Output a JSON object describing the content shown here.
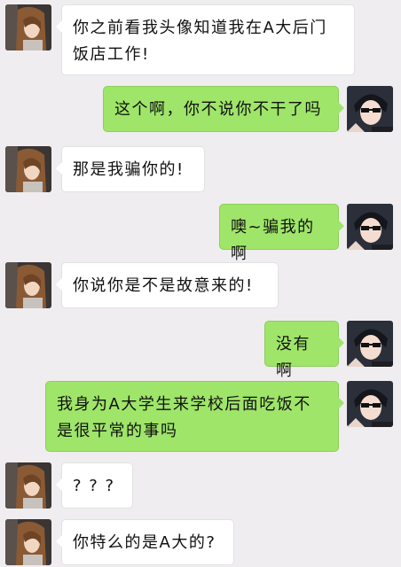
{
  "messages": [
    {
      "side": "left",
      "text": "你之前看我头像知道我在A大后门饭店工作!"
    },
    {
      "side": "right",
      "text": "这个啊，你不说你不干了吗"
    },
    {
      "side": "left",
      "text": "那是我骗你的!"
    },
    {
      "side": "right",
      "text": "噢~骗我的啊"
    },
    {
      "side": "left",
      "text": "你说你是不是故意来的!"
    },
    {
      "side": "right",
      "text": "没有啊"
    },
    {
      "side": "right",
      "text": "我身为A大学生来学校后面吃饭不是很平常的事吗"
    },
    {
      "side": "left",
      "text": "? ? ?"
    },
    {
      "side": "left",
      "text": "你特么的是A大的?"
    }
  ],
  "avatars": {
    "left_icon": "girl-avatar-icon",
    "right_icon": "boy-avatar-icon"
  },
  "colors": {
    "background": "#efedf0",
    "outgoing_bubble": "#9fe569",
    "incoming_bubble": "#ffffff"
  }
}
